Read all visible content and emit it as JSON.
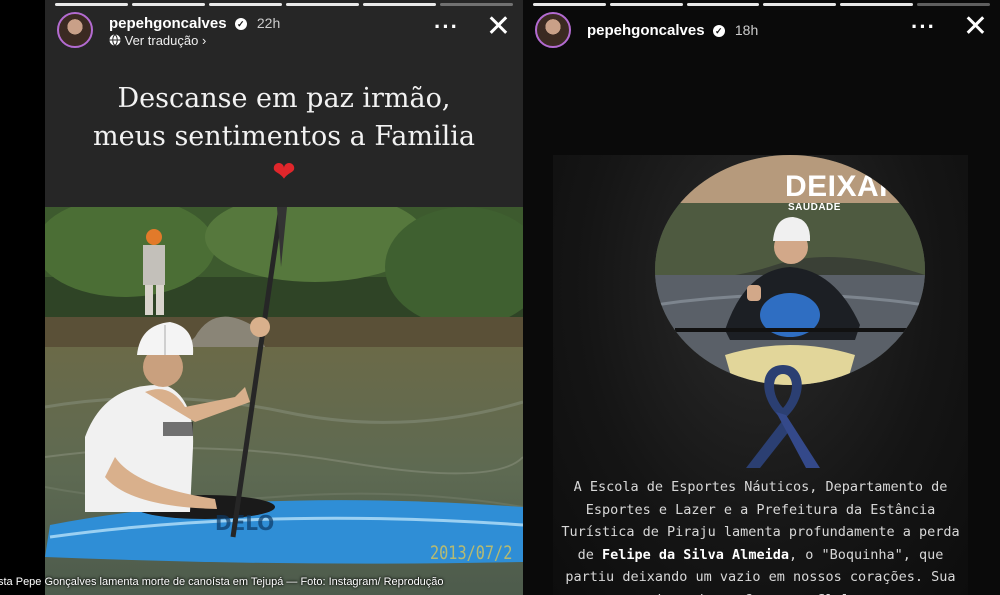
{
  "story_left": {
    "username": "pepehgoncalves",
    "time": "22h",
    "translate_label": "Ver tradução",
    "text_line1": "Descanse em paz irmão,",
    "text_line2": "meus sentimentos a Familia",
    "photo_date_stamp": "2013/07/2"
  },
  "story_right": {
    "username": "pepehgoncalves",
    "time": "18h",
    "card_title": "DEIXAR",
    "card_subtitle": "SAUDADE",
    "paragraph": {
      "part1": "A Escola de Esportes Náuticos, Departamento de Esportes e Lazer e a Prefeitura da Estância Turística de Piraju lamenta profundamente a perda de",
      "name": "Felipe da Silva Almeida",
      "part2": ", o \"Boquinha\", que partiu deixando um vazio em nossos corações. Sua jornada na Canoagem Slalom"
    }
  },
  "caption": "sta Pepe Gonçalves lamenta morte de canoísta em Tejupá — Foto: Instagram/ Reprodução",
  "icons": [
    "verified-icon",
    "globe-icon",
    "chevron-right-icon",
    "more-icon",
    "close-icon",
    "heart-icon",
    "mourning-ribbon-icon"
  ],
  "colors": {
    "ribbon": "#2b3f72",
    "heart": "#e0262b",
    "kayak": "#2f8ed6",
    "story_bg": "#262626"
  }
}
